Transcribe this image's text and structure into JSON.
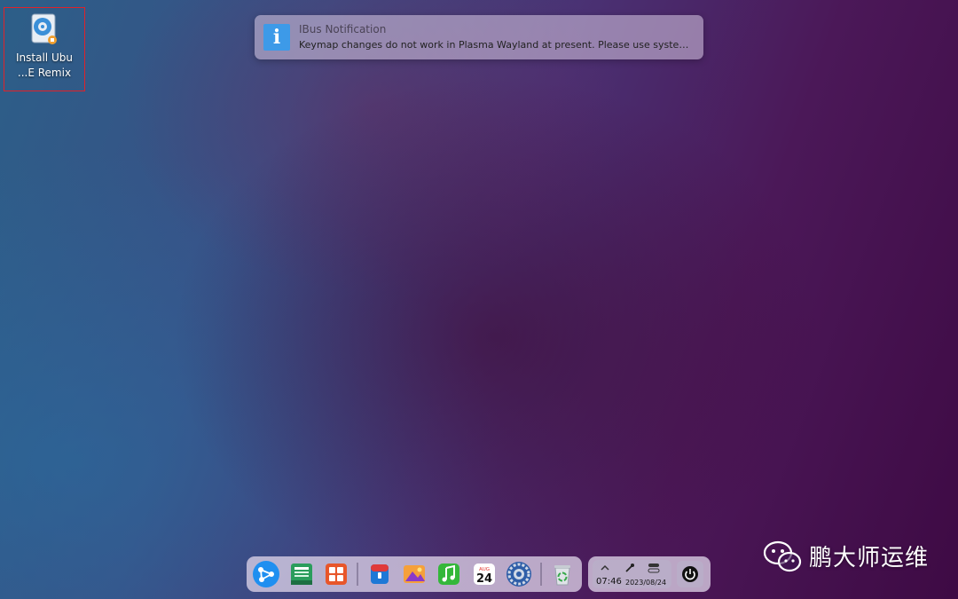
{
  "desktop": {
    "icons": [
      {
        "label_line1": "Install Ubu",
        "label_line2": "...E Remix",
        "icon": "installer-disc-icon"
      }
    ]
  },
  "notification": {
    "app": "IBus Notification",
    "body": "Keymap changes do not work in Plasma Wayland at present. Please use systemsettin...",
    "icon": "info-icon",
    "accent": "#3d9ae8"
  },
  "dock": {
    "apps": [
      {
        "name": "launcher",
        "icon": "network-launcher-icon"
      },
      {
        "name": "file-manager",
        "icon": "folder-book-icon"
      },
      {
        "name": "app-grid",
        "icon": "grid-apps-icon"
      },
      {
        "name": "app-store",
        "icon": "store-box-icon"
      },
      {
        "name": "photos",
        "icon": "photos-icon"
      },
      {
        "name": "music",
        "icon": "music-note-icon"
      },
      {
        "name": "calendar",
        "icon": "calendar-icon",
        "month": "AUG",
        "day": "24"
      },
      {
        "name": "settings",
        "icon": "gear-icon"
      },
      {
        "name": "trash",
        "icon": "recycle-bin-icon"
      }
    ]
  },
  "tray": {
    "time": "07:46",
    "date": "2023/08/24",
    "icons": [
      "chevron-up-icon",
      "pin-icon",
      "toggle-icon",
      "power-icon"
    ]
  },
  "watermark": {
    "text": "鹏大师运维",
    "icon": "wechat-icon"
  }
}
